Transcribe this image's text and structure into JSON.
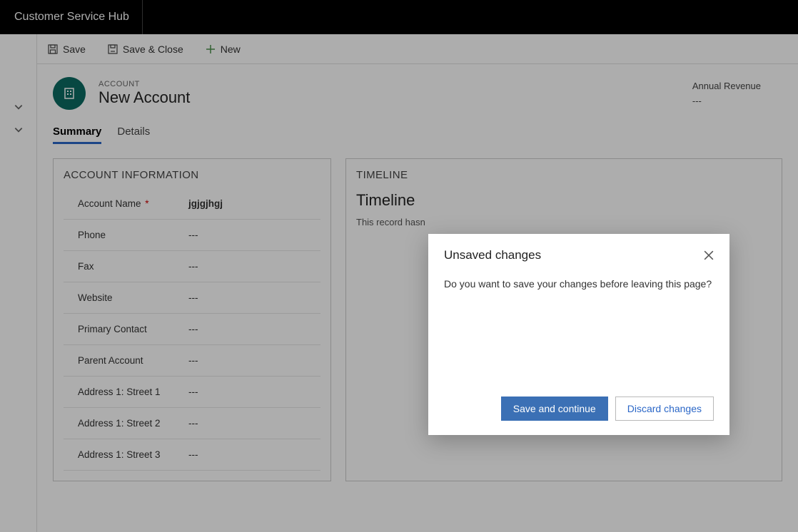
{
  "app": {
    "title": "Customer Service Hub"
  },
  "commands": {
    "save": "Save",
    "save_close": "Save & Close",
    "new": "New"
  },
  "header": {
    "entity_label": "ACCOUNT",
    "entity_title": "New Account",
    "metric_label": "Annual Revenue",
    "metric_value": "---"
  },
  "tabs": {
    "summary": "Summary",
    "details": "Details"
  },
  "account_info": {
    "title": "ACCOUNT INFORMATION",
    "fields": [
      {
        "label": "Account Name",
        "value": "jgjgjhgj",
        "required": true
      },
      {
        "label": "Phone",
        "value": "---"
      },
      {
        "label": "Fax",
        "value": "---"
      },
      {
        "label": "Website",
        "value": "---"
      },
      {
        "label": "Primary Contact",
        "value": "---"
      },
      {
        "label": "Parent Account",
        "value": "---"
      },
      {
        "label": "Address 1: Street 1",
        "value": "---"
      },
      {
        "label": "Address 1: Street 2",
        "value": "---"
      },
      {
        "label": "Address 1: Street 3",
        "value": "---"
      }
    ]
  },
  "timeline": {
    "title": "TIMELINE",
    "subtitle": "Timeline",
    "message": "This record hasn"
  },
  "dialog": {
    "title": "Unsaved changes",
    "message": "Do you want to save your changes before leaving this page?",
    "primary": "Save and continue",
    "secondary": "Discard changes"
  }
}
